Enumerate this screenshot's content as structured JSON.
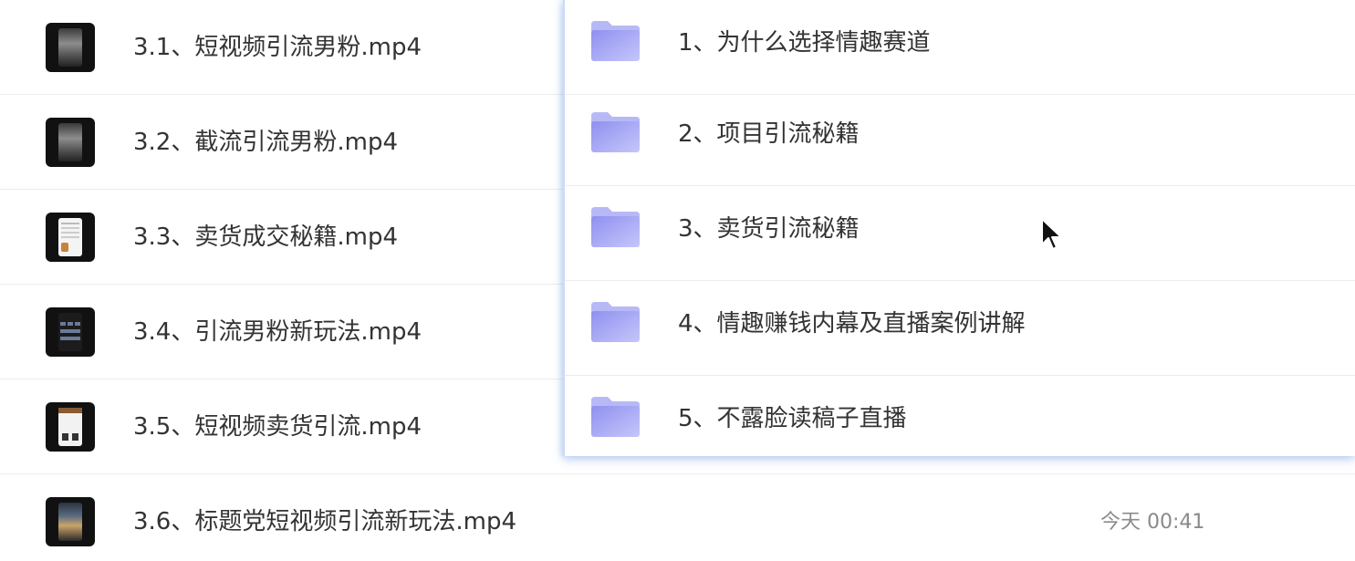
{
  "files": [
    {
      "name": "3.1、短视频引流男粉.mp4",
      "thumbnail": "video-thumbnail",
      "time": ""
    },
    {
      "name": "3.2、截流引流男粉.mp4",
      "thumbnail": "video-thumbnail",
      "time": ""
    },
    {
      "name": "3.3、卖货成交秘籍.mp4",
      "thumbnail": "video-thumbnail",
      "time": ""
    },
    {
      "name": "3.4、引流男粉新玩法.mp4",
      "thumbnail": "video-thumbnail",
      "time": ""
    },
    {
      "name": "3.5、短视频卖货引流.mp4",
      "thumbnail": "video-thumbnail",
      "time": ""
    },
    {
      "name": "3.6、标题党短视频引流新玩法.mp4",
      "thumbnail": "video-thumbnail",
      "time": "今天 00:41"
    }
  ],
  "folders": [
    {
      "name": "1、为什么选择情趣赛道",
      "icon": "folder-icon"
    },
    {
      "name": "2、项目引流秘籍",
      "icon": "folder-icon"
    },
    {
      "name": "3、卖货引流秘籍",
      "icon": "folder-icon"
    },
    {
      "name": "4、情趣赚钱内幕及直播案例讲解",
      "icon": "folder-icon"
    },
    {
      "name": "5、不露脸读稿子直播",
      "icon": "folder-icon"
    }
  ],
  "colors": {
    "folder_light": "#b7b9f7",
    "folder_dark": "#8f90ef",
    "text": "#333333",
    "muted_text": "#8a8a8a",
    "drag_outline": "#c9dcf7"
  }
}
